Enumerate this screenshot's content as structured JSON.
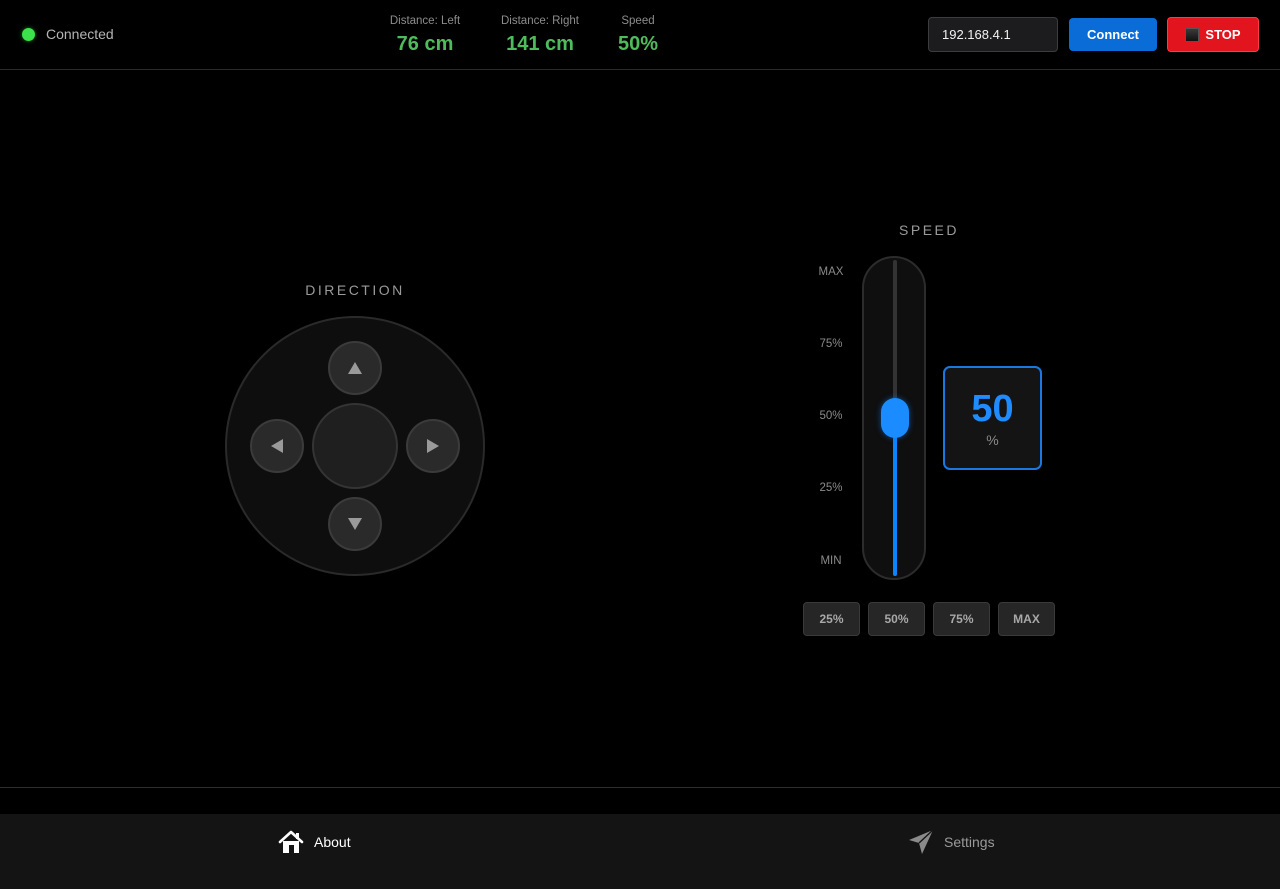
{
  "header": {
    "status": {
      "text": "Connected",
      "color": "#3be24c"
    },
    "stats": [
      {
        "label": "Distance: Left",
        "value": "76 cm"
      },
      {
        "label": "Distance: Right",
        "value": "141 cm"
      },
      {
        "label": "Speed",
        "value": "50%"
      }
    ],
    "ip_input": {
      "value": "192.168.4.1"
    },
    "connect_label": "Connect",
    "stop_label": "STOP",
    "accent_color": "#0a6cd6",
    "stop_color": "#e2141e"
  },
  "direction": {
    "title": "DIRECTION",
    "buttons": [
      "up-arrow-icon",
      "left-arrow-icon",
      "right-arrow-icon",
      "down-arrow-icon"
    ]
  },
  "speed": {
    "title": "SPEED",
    "scale": [
      "MAX",
      "75%",
      "50%",
      "25%",
      "MIN"
    ],
    "value_percent": 50,
    "display_value": "50",
    "unit": "%",
    "presets": [
      "25%",
      "50%",
      "75%",
      "MAX"
    ],
    "fill_color": "#0a84ff"
  },
  "tabs": [
    {
      "label": "About",
      "icon": "home-icon",
      "active": true
    },
    {
      "label": "Settings",
      "icon": "paper-plane-icon",
      "active": false
    }
  ]
}
